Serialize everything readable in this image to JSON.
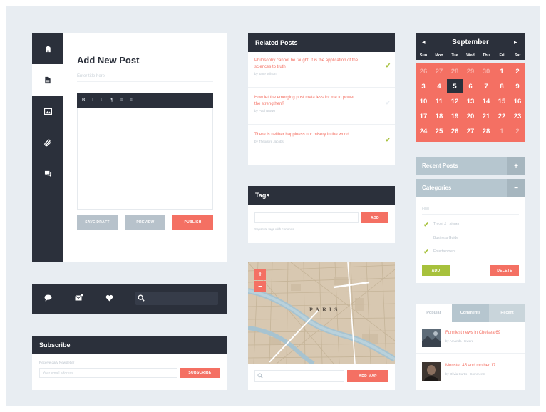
{
  "editor": {
    "title": "Add New Post",
    "title_placeholder": "Enter title here",
    "toolbar": [
      "B",
      "I",
      "U",
      "¶",
      "≡",
      "≡"
    ],
    "buttons": {
      "save_draft": "SAVE DRAFT",
      "preview": "PREVIEW",
      "publish": "PUBLISH"
    }
  },
  "side_nav": {
    "icons": [
      "home-icon",
      "document-icon",
      "image-icon",
      "attachment-icon",
      "comments-icon"
    ],
    "active_index": 1
  },
  "action_bar": {
    "icons": [
      "chat-icon",
      "mail-icon",
      "heart-icon",
      "search-icon"
    ]
  },
  "subscribe": {
    "title": "Subscribe",
    "label": "Receive daily Newsletter",
    "placeholder": "Your email address",
    "button": "SUBSCRIBE"
  },
  "related_posts": {
    "title": "Related Posts",
    "items": [
      {
        "title": "Philosophy cannot be taught; it is the application of the sciences to truth",
        "meta": "by Jane Wilson",
        "checked": true
      },
      {
        "title": "How let the emerging post meta less for me to power the strengthen?",
        "meta": "by Paul Brown",
        "checked": false
      },
      {
        "title": "There is neither happiness nor misery in the world",
        "meta": "by Theodore Jacobs",
        "checked": true
      }
    ]
  },
  "tags": {
    "title": "Tags",
    "placeholder": "",
    "button": "ADD",
    "hint": "Separate tags with commas"
  },
  "map": {
    "label": "PARIS",
    "zoom_in": "+",
    "zoom_out": "−",
    "search_placeholder": "",
    "button": "ADD MAP"
  },
  "calendar": {
    "month": "September",
    "prev": "◂",
    "next": "▸",
    "weekdays": [
      "Sun",
      "Mon",
      "Tue",
      "Wed",
      "Thu",
      "Fri",
      "Sat"
    ],
    "weeks": [
      [
        "26",
        "27",
        "28",
        "29",
        "30",
        "1",
        "2"
      ],
      [
        "3",
        "4",
        "5",
        "6",
        "7",
        "8",
        "9"
      ],
      [
        "10",
        "11",
        "12",
        "13",
        "14",
        "15",
        "16"
      ],
      [
        "17",
        "18",
        "19",
        "20",
        "21",
        "22",
        "23"
      ],
      [
        "24",
        "25",
        "26",
        "27",
        "28",
        "1",
        "2"
      ]
    ],
    "today": "5"
  },
  "accordion": {
    "recent_posts": "Recent Posts",
    "categories": "Categories",
    "recent_toggle": "+",
    "categories_toggle": "−"
  },
  "categories": {
    "placeholder": "Find",
    "items": [
      {
        "label": "Travel & Leisure",
        "checked": true
      },
      {
        "label": "Business Guide",
        "checked": false
      },
      {
        "label": "Entertainment",
        "checked": true
      }
    ],
    "add": "ADD",
    "delete": "DELETE"
  },
  "tabs": {
    "labels": [
      "Popular",
      "Comments",
      "Recent"
    ],
    "active_index": 0,
    "posts": [
      {
        "title": "Funniest news in Chelsea 69",
        "meta": "by Amanda Howard"
      },
      {
        "title": "Monster 45 and mother 17",
        "meta": "by Olivia Curtis · Comments"
      }
    ]
  },
  "colors": {
    "dark": "#2b303b",
    "accent": "#f47063",
    "light_gray": "#b7c2cb",
    "green": "#a7c13c",
    "background": "#e8edf2"
  }
}
